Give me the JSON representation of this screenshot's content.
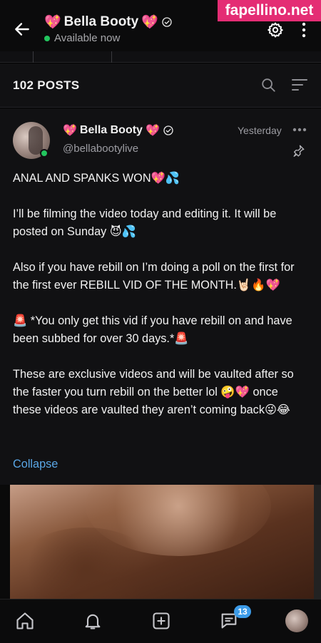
{
  "watermark": "fapellino.net",
  "header": {
    "name": "Bella Booty",
    "status": "Available now"
  },
  "posts_bar": {
    "count_label": "102 POSTS"
  },
  "post": {
    "name": "Bella Booty",
    "handle": "@bellabootylive",
    "time": "Yesterday",
    "text": "ANAL AND SPANKS WON💖💦\n\nI’ll be filming the video today and editing it. It will be posted on Sunday 😈💦\n\nAlso if you have rebill on I’m doing a poll on the first for the first ever REBILL VID OF THE MONTH.🤘🏻🔥💖\n\n🚨 *You only get this vid if you have rebill on and have been subbed for over 30 days.*🚨\n\nThese are exclusive videos and will be vaulted after so the faster you turn rebill on the better lol 🤪💖 once these videos are vaulted they aren’t coming back😜😂",
    "collapse_label": "Collapse"
  },
  "bottom_nav": {
    "messages_badge": "13"
  },
  "colors": {
    "accent_link": "#5aa7e6",
    "online": "#22c55e",
    "badge": "#3c9be8",
    "watermark_bg": "#e42d74"
  }
}
